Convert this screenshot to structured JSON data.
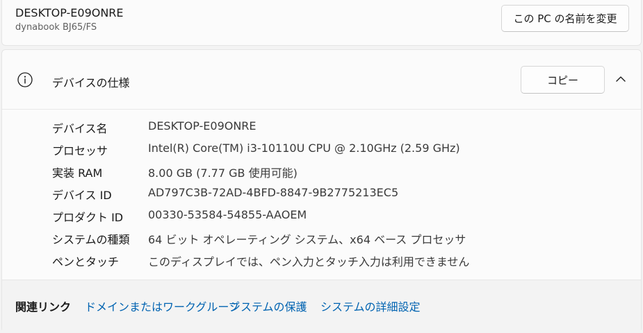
{
  "device": {
    "name": "DESKTOP-E09ONRE",
    "model": "dynabook BJ65/FS",
    "rename_label": "この PC の名前を変更"
  },
  "specs": {
    "title": "デバイスの仕様",
    "copy_label": "コピー",
    "rows": [
      {
        "label": "デバイス名",
        "value": "DESKTOP-E09ONRE"
      },
      {
        "label": "プロセッサ",
        "value": "Intel(R) Core(TM) i3-10110U CPU @ 2.10GHz (2.59 GHz)"
      },
      {
        "label": "実装 RAM",
        "value": "8.00 GB (7.77 GB 使用可能)"
      },
      {
        "label": "デバイス ID",
        "value": "AD797C3B-72AD-4BFD-8847-9B2775213EC5"
      },
      {
        "label": "プロダクト ID",
        "value": "00330-53584-54855-AAOEM"
      },
      {
        "label": "システムの種類",
        "value": "64 ビット オペレーティング システム、x64 ベース プロセッサ"
      },
      {
        "label": "ペンとタッチ",
        "value": "このディスプレイでは、ペン入力とタッチ入力は利用できません"
      }
    ]
  },
  "related": {
    "title": "関連リンク",
    "links": [
      "ドメインまたはワークグループ",
      "システムの保護",
      "システムの詳細設定"
    ]
  },
  "icons": {
    "info": "info-icon",
    "collapse": "chevron-up-icon"
  },
  "colors": {
    "link": "#0063b1",
    "background": "#f3f3f3",
    "card": "#fbfbfb"
  }
}
